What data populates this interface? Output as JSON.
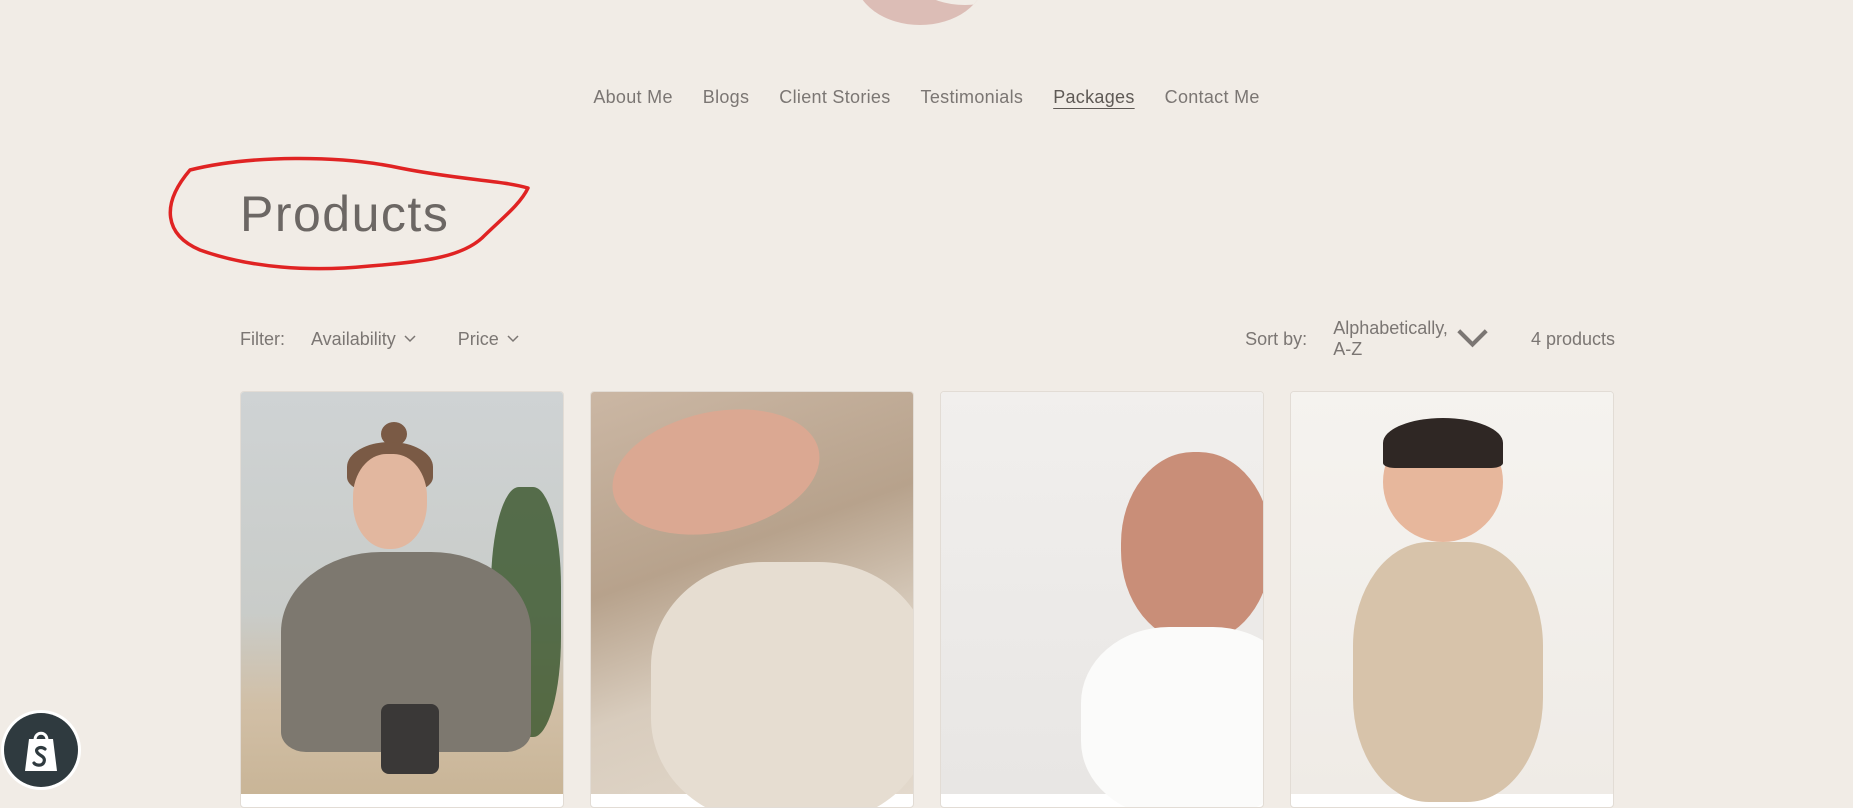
{
  "nav": {
    "items": [
      {
        "label": "About Me"
      },
      {
        "label": "Blogs"
      },
      {
        "label": "Client Stories"
      },
      {
        "label": "Testimonials"
      },
      {
        "label": "Packages",
        "active": true
      },
      {
        "label": "Contact Me"
      }
    ]
  },
  "page": {
    "title": "Products"
  },
  "filters": {
    "label": "Filter:",
    "availability": "Availability",
    "price": "Price",
    "sort_label": "Sort by:",
    "sort_value": "Alphabetically, A-Z",
    "product_count": "4 products"
  },
  "products": [
    {
      "image": "woman-holding-mug"
    },
    {
      "image": "hands-holding-baby"
    },
    {
      "image": "sleeping-newborn"
    },
    {
      "image": "smiling-swaddled-baby"
    }
  ],
  "colors": {
    "background": "#f1ece6",
    "annotation": "#e02323",
    "text": "#6f6a66"
  },
  "icons": {
    "dropdown": "chevron-down-icon",
    "shop": "shopify-bag-icon"
  }
}
